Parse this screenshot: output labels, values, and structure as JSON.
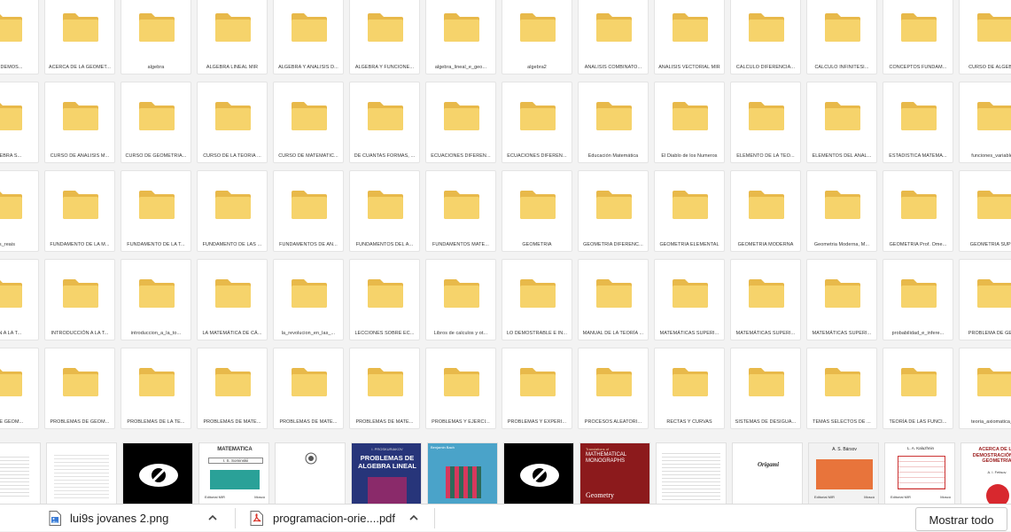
{
  "folder_rows": [
    [
      "...E LA DEMOS...",
      "ACERCA DE LA GEOMET...",
      "algebra",
      "ALGEBRA LINEAL MIR",
      "ALGEBRA Y ANALISIS D...",
      "ALGEBRA Y FUNCIONE...",
      "algebra_lineal_e_geo...",
      "algebra2",
      "ANALISIS COMBINATO...",
      "ANALISIS VECTORIAL MIR",
      "CALCULO DIFERENCIA...",
      "CALCULO INFINITESI...",
      "CONCEPTOS FUNDAM...",
      "CURSO DE ALGEBR..."
    ],
    [
      "...ALGEBRA S...",
      "CURSO DE ANALISIS M...",
      "CURSO DE GEOMETRIA...",
      "CURSO DE LA TEORIA ...",
      "CURSO DE MATEMATIC...",
      "DE CUANTAS FORMAS, ...",
      "ECUACIONES DIFEREN...",
      "ECUACIONES DIFEREN...",
      "Educación Matemática",
      "El Diablo de los Numeros",
      "ELEMENTO DE LA TEO...",
      "ELEMENTOS DEL ANAL...",
      "ESTADISTICA MATEMA...",
      "funciones_variable..."
    ],
    [
      "...es_reais",
      "FUNDAMENTO DE LA M...",
      "FUNDAMENTO DE LA T...",
      "FUNDAMENTO DE LAS ...",
      "FUNDAMENTOS DE AN...",
      "FUNDAMENTOS DEL A...",
      "FUNDAMENTOS MATE...",
      "GEOMETRIA",
      "GEOMETRIA DIFERENC...",
      "GEOMETRIA ELEMENTAL",
      "GEOMETRIA MODERNA",
      "Geometria Moderna, M...",
      "GEOMETRIA Prof. Ome...",
      "GEOMETRIA SUPE..."
    ],
    [
      "...CIÓN A LA T...",
      "INTRODUCCIÓN A LA T...",
      "introduccion_a_la_to...",
      "LA MATEMÁTICA DE CÁ...",
      "la_revolucion_en_las_...",
      "LECCIONES SOBRE EC...",
      "Libros de calculos y ot...",
      "LO DEMOSTRABLE E IN...",
      "MANUAL DE LA TEORÍA ...",
      "MATEMÁTICAS SUPERI...",
      "MATEMÁTICAS SUPERI...",
      "MATEMÁTICAS SUPERI...",
      "probabilidad_e_infere...",
      "PROBLEMA DE GEO..."
    ],
    [
      "...AS DE GEOM...",
      "PROBLEMAS DE GEOM...",
      "PROBLEMAS DE LA TE...",
      "PROBLEMAS DE MATE...",
      "PROBLEMAS DE MATE...",
      "PROBLEMAS DE MATE...",
      "PROBLEMAS Y EJERCI...",
      "PROBLEMAS Y EXPERI...",
      "PROCESOS ALEATORI...",
      "RECTAS Y CURVAS",
      "SISTEMAS DE DESIGUA...",
      "TEMAS SELECTOS DE ...",
      "TEORÍA DE LAS FUNCI...",
      "teoria_axiomatica_..."
    ]
  ],
  "thumbnails": {
    "book_matematica_title": "MATEMATICA",
    "book_matematica_author": "I. S. Sominskii",
    "book_matematica_publisher": "Editorial MIR",
    "book_matematica_city": "Moscú",
    "book_problemas_top": "I. PROSKURIAKOV",
    "book_problemas_title": "PROBLEMAS DE ALGEBRA LINEAL",
    "book_bach_author": "Benjamin Bach",
    "book_monographs_top": "Translations of",
    "book_monographs_title": "MATHEMATICAL MONOGRAPHS",
    "book_monographs_bottom": "Geometry",
    "book_origami_title": "Origami",
    "book_barsov_author": "A. S. Bársov",
    "book_barsov_publisher": "Editorial MIR",
    "book_barsov_city": "Moscú",
    "book_kolesnik_author": "L. A. Kaluzhnin",
    "book_kolesnik_publisher": "Editorial MIR",
    "book_kolesnik_city": "Moscú",
    "book_acerca_title": "ACERCA DE LA DEMOSTRACIÓN EN GEOMETRÍA",
    "book_acerca_author": "A. I. Fetisov"
  },
  "download_bar": {
    "items": [
      {
        "name": "lui9s jovanes 2.png",
        "icon": "image-file-icon"
      },
      {
        "name": "programacion-orie....pdf",
        "icon": "pdf-file-icon"
      }
    ],
    "show_all_label": "Mostrar todo"
  },
  "colors": {
    "folder_back": "#e8b94a",
    "folder_front": "#f6d36b",
    "background": "#f3f3f3"
  }
}
